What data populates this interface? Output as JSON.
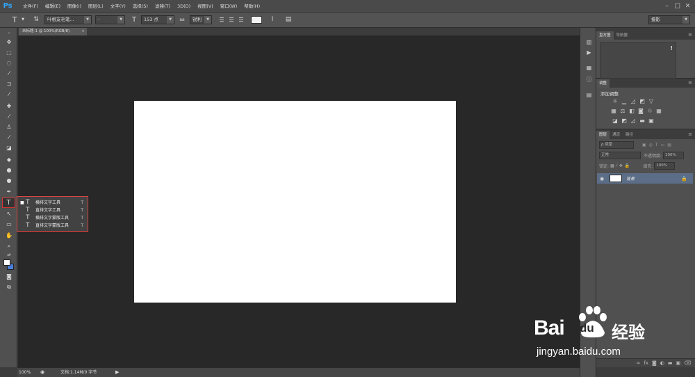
{
  "app": {
    "logo": "Ps"
  },
  "menu": [
    "文件(F)",
    "编辑(E)",
    "图像(I)",
    "图层(L)",
    "文字(Y)",
    "选择(S)",
    "滤镜(T)",
    "3D(D)",
    "视图(V)",
    "窗口(W)",
    "帮助(H)"
  ],
  "window_controls": {
    "minimize": "–",
    "maximize": "□",
    "close": "✕"
  },
  "options": {
    "tool_glyph": "T",
    "font_family": "叶根友毛笔...",
    "font_style": "-",
    "font_size": "153 点",
    "aa_label": "aa",
    "antialias": "锐利",
    "workspace": "摄影"
  },
  "document_tab": {
    "title": "未标题-1 @ 100%(RGB/8)",
    "close": "×"
  },
  "flyout": {
    "items": [
      {
        "label": "横排文字工具",
        "key": "T",
        "selected": true,
        "icon": "T"
      },
      {
        "label": "直排文字工具",
        "key": "T",
        "selected": false,
        "icon": "T"
      },
      {
        "label": "横排文字蒙版工具",
        "key": "T",
        "selected": false,
        "icon": "T"
      },
      {
        "label": "直排文字蒙版工具",
        "key": "T",
        "selected": false,
        "icon": "T"
      }
    ]
  },
  "statusbar": {
    "zoom": "100%",
    "doc_info": "文档:1.14M/0 字节"
  },
  "panels": {
    "histogram": {
      "tabs": [
        "直方图",
        "导航器"
      ],
      "warning": "!"
    },
    "adjustments": {
      "tab": "调整",
      "title": "添加调整"
    },
    "layers": {
      "tabs": [
        "图层",
        "通道",
        "路径"
      ],
      "filter": "ρ 类型",
      "blend_mode": "正常",
      "opacity_label": "不透明度:",
      "opacity_value": "100%",
      "lock_label": "锁定:",
      "fill_label": "填充:",
      "fill_value": "100%",
      "layer_name": "背景"
    }
  },
  "watermark": {
    "brand_bai": "Bai",
    "brand_du": "du",
    "brand_cn": "经验",
    "url": "jingyan.baidu.com"
  },
  "colors": {
    "accent": "#31a8ff",
    "highlight_border": "#dd4444",
    "layer_selected": "#5b6d87"
  }
}
